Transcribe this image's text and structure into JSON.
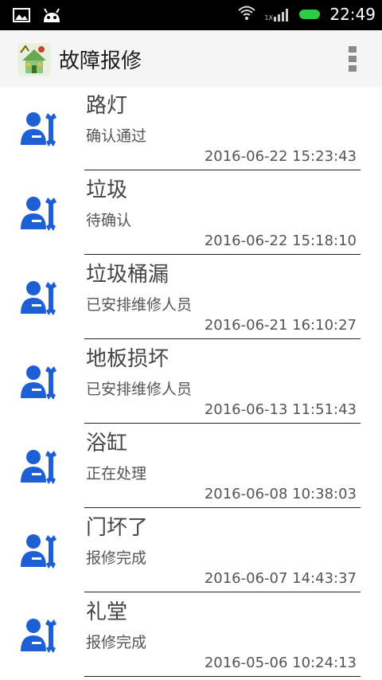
{
  "status_bar": {
    "time": "22:49",
    "network_label": "1X"
  },
  "toolbar": {
    "title": "故障报修"
  },
  "items": [
    {
      "title": "路灯",
      "status": "确认通过",
      "time": "2016-06-22 15:23:43"
    },
    {
      "title": "垃圾",
      "status": "待确认",
      "time": "2016-06-22 15:18:10"
    },
    {
      "title": "垃圾桶漏",
      "status": "已安排维修人员",
      "time": "2016-06-21 16:10:27"
    },
    {
      "title": "地板损坏",
      "status": "已安排维修人员",
      "time": "2016-06-13 11:51:43"
    },
    {
      "title": "浴缸",
      "status": "正在处理",
      "time": "2016-06-08 10:38:03"
    },
    {
      "title": "门坏了",
      "status": "报修完成",
      "time": "2016-06-07 14:43:37"
    },
    {
      "title": "礼堂",
      "status": "报修完成",
      "time": "2016-05-06 10:24:13"
    }
  ],
  "colors": {
    "avatar": "#1f5fd6",
    "battery": "#2ecc40"
  },
  "icons": {
    "list_item": "repairman-wrench-icon",
    "overflow": "overflow-menu-icon"
  }
}
